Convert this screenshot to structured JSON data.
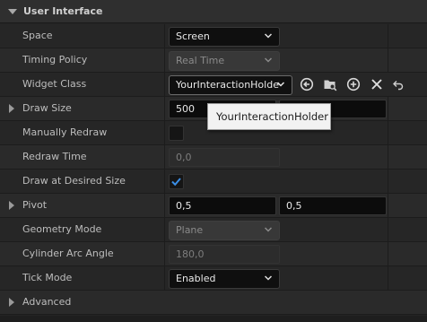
{
  "section": {
    "title": "User Interface"
  },
  "properties": {
    "space": {
      "label": "Space",
      "value": "Screen"
    },
    "timing_policy": {
      "label": "Timing Policy",
      "value": "Real Time"
    },
    "widget_class": {
      "label": "Widget Class",
      "value": "YourInteractionHolde"
    },
    "draw_size": {
      "label": "Draw Size",
      "x": "500"
    },
    "manually_redraw": {
      "label": "Manually Redraw",
      "checked": false
    },
    "redraw_time": {
      "label": "Redraw Time",
      "value": "0,0"
    },
    "draw_at_desired_size": {
      "label": "Draw at Desired Size",
      "checked": true
    },
    "pivot": {
      "label": "Pivot",
      "x": "0,5",
      "y": "0,5"
    },
    "geometry_mode": {
      "label": "Geometry Mode",
      "value": "Plane"
    },
    "cylinder_arc_angle": {
      "label": "Cylinder Arc Angle",
      "value": "180,0"
    },
    "tick_mode": {
      "label": "Tick Mode",
      "value": "Enabled"
    }
  },
  "advanced": {
    "label": "Advanced"
  },
  "tooltip": {
    "text": "YourInteractionHolder"
  },
  "icons": [
    "back-arrow-icon",
    "browse-asset-icon",
    "add-icon",
    "clear-icon",
    "reset-icon"
  ],
  "colors": {
    "accent_check": "#3a8ee6",
    "panel_bg": "#242424"
  }
}
